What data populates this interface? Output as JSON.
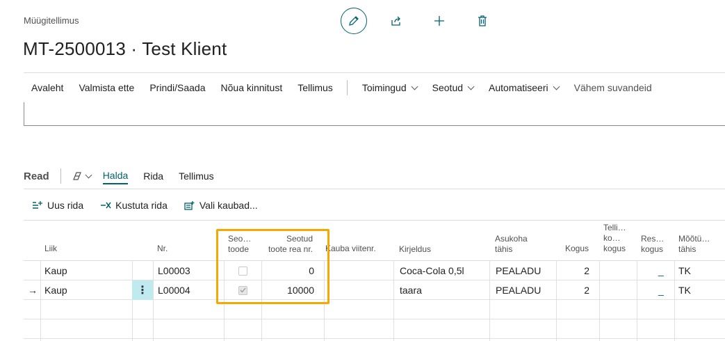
{
  "header": {
    "caption": "Müügitellimus",
    "title": "MT-2500013 · Test Klient"
  },
  "top_actions": [
    {
      "name": "edit-icon"
    },
    {
      "name": "share-icon"
    },
    {
      "name": "plus-icon"
    },
    {
      "name": "delete-icon"
    }
  ],
  "menu": {
    "items": [
      "Avaleht",
      "Valmista ette",
      "Prindi/Saada",
      "Nõua kinnitust",
      "Tellimus"
    ],
    "dropdowns": [
      "Toimingud",
      "Seotud",
      "Automatiseeri"
    ],
    "fewer_options": "Vähem suvandeid"
  },
  "lines": {
    "title": "Read",
    "tabs": [
      "Halda",
      "Rida",
      "Tellimus"
    ],
    "active_tab": "Halda",
    "actions": {
      "new_line": "Uus rida",
      "delete_line": "Kustuta rida",
      "select_items": "Vali kaubad..."
    }
  },
  "table": {
    "headers": {
      "type": "Liik",
      "no": "Nr.",
      "linked_item_1": "Seo…",
      "linked_item_2": "toode",
      "linked_line_1": "Seotud",
      "linked_line_2": "toote rea nr.",
      "item_ref": "Kauba viitenr.",
      "description": "Kirjeldus",
      "location_1": "Asukoha",
      "location_2": "tähis",
      "quantity": "Kogus",
      "qty_to_order_1": "Telli…",
      "qty_to_order_2": "ko…",
      "qty_to_order_3": "kogus",
      "reserved_1": "Res…",
      "reserved_2": "kogus",
      "uom_1": "Mõõtü…",
      "uom_2": "tähis"
    },
    "rows": [
      {
        "type": "Kaup",
        "no": "L00003",
        "linked": false,
        "linked_line": "0",
        "description": "Coca-Cola 0,5l",
        "location": "PEALADU",
        "quantity": "2",
        "reserved": "_",
        "uom": "TK"
      },
      {
        "type": "Kaup",
        "no": "L00004",
        "linked": true,
        "linked_line": "10000",
        "description": "taara",
        "location": "PEALADU",
        "quantity": "2",
        "reserved": "_",
        "uom": "TK"
      }
    ],
    "current_row_marker": "→",
    "row_menu_glyph": "⋮"
  },
  "colors": {
    "accent": "#00626f",
    "highlight": "#f5a800"
  }
}
